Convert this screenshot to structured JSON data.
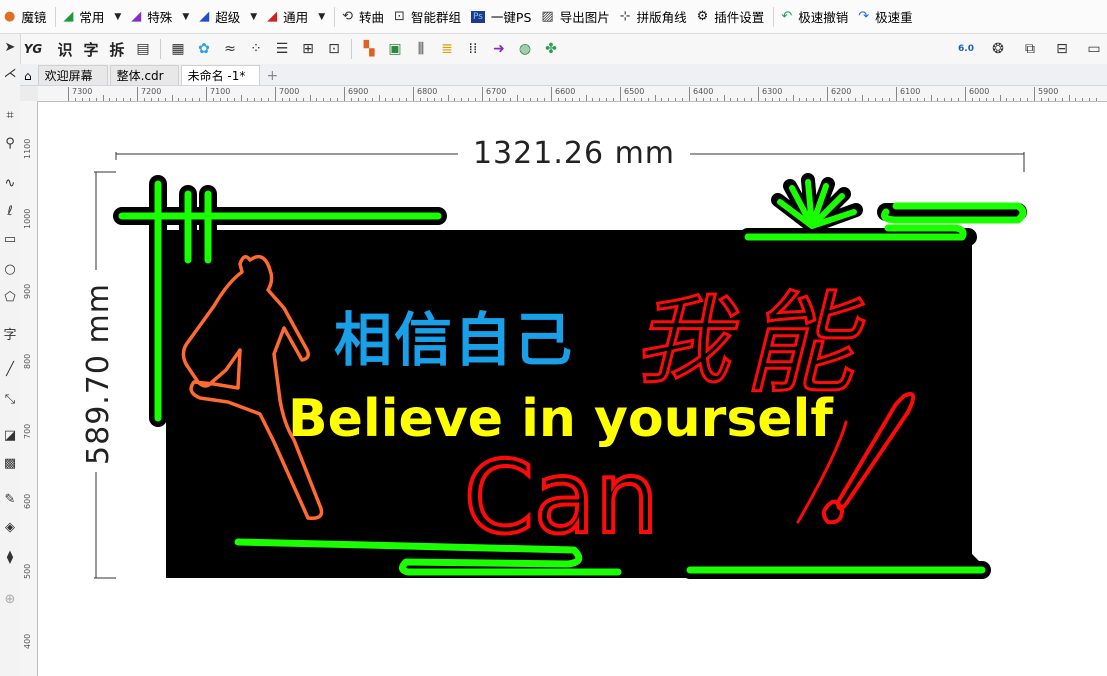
{
  "toolbar": {
    "items": [
      {
        "label": "魔镜",
        "icon": "mirror-icon",
        "color": "#e07020",
        "dropdown": false
      },
      {
        "label": "常用",
        "icon": "pen-green-icon",
        "color": "#1a9a3a",
        "dropdown": true
      },
      {
        "label": "特殊",
        "icon": "pen-purple-icon",
        "color": "#8a2ac8",
        "dropdown": true
      },
      {
        "label": "超级",
        "icon": "pen-blue-icon",
        "color": "#1f4fd0",
        "dropdown": true
      },
      {
        "label": "通用",
        "icon": "pen-red-icon",
        "color": "#d02020",
        "dropdown": true
      },
      {
        "label": "转曲",
        "icon": "convert-curve-icon",
        "color": "#333333",
        "dropdown": false
      },
      {
        "label": "智能群组",
        "icon": "group-icon",
        "color": "#333333",
        "dropdown": false
      },
      {
        "label": "一键PS",
        "icon": "photoshop-icon",
        "color": "#1e3a8a",
        "dropdown": false
      },
      {
        "label": "导出图片",
        "icon": "image-icon",
        "color": "#333333",
        "dropdown": false
      },
      {
        "label": "拼版角线",
        "icon": "crop-marks-icon",
        "color": "#333333",
        "dropdown": false
      },
      {
        "label": "插件设置",
        "icon": "gear-icon",
        "color": "#111111",
        "dropdown": false
      },
      {
        "label": "极速撤销",
        "icon": "undo-icon",
        "color": "#1aa050",
        "dropdown": false
      },
      {
        "label": "极速重",
        "icon": "redo-icon",
        "color": "#1a70d0",
        "dropdown": false
      }
    ]
  },
  "toolbar2": {
    "text_buttons": [
      "YG",
      "识",
      "字",
      "拆"
    ],
    "badge": "6.0"
  },
  "tabs": [
    {
      "label": "欢迎屏幕",
      "active": false
    },
    {
      "label": "整体.cdr",
      "active": false
    },
    {
      "label": "未命名 -1*",
      "active": true
    }
  ],
  "hruler": [
    "7300",
    "7200",
    "7100",
    "7000",
    "6900",
    "6800",
    "6700",
    "6600",
    "6500",
    "6400",
    "6300",
    "6200",
    "6100",
    "6000",
    "5900"
  ],
  "vruler": [
    "1100",
    "1000",
    "900",
    "800",
    "700",
    "600",
    "500",
    "400"
  ],
  "artwork": {
    "width_dim": "1321.26 mm",
    "height_dim": "589.70 mm",
    "text_chinese": "相信自己",
    "text_english": "Believe in yourself",
    "text_script": "我",
    "text_script2": "能",
    "text_can": "Can",
    "colors": {
      "green": "#19ff00",
      "blue": "#1aa0e8",
      "yellow": "#ffff00",
      "red": "#ff0a0a",
      "orange": "#ff6a30",
      "board": "#000000"
    }
  }
}
